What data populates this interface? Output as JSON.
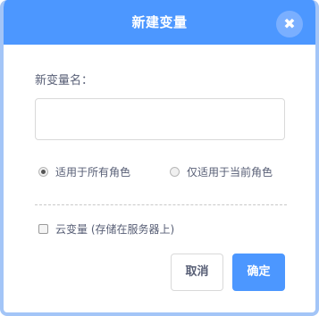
{
  "dialog": {
    "title": "新建变量",
    "close_icon": "close-icon",
    "close_glyph": "✖"
  },
  "form": {
    "name_label": "新变量名：",
    "name_value": "",
    "name_placeholder": "",
    "scope_options": [
      {
        "label": "适用于所有角色",
        "selected": true
      },
      {
        "label": "仅适用于当前角色",
        "selected": false
      }
    ],
    "cloud_label": "云变量 (存储在服务器上)",
    "cloud_checked": false
  },
  "buttons": {
    "cancel_label": "取消",
    "ok_label": "确定"
  },
  "colors": {
    "accent": "#4c97ff",
    "text": "#575e75"
  }
}
